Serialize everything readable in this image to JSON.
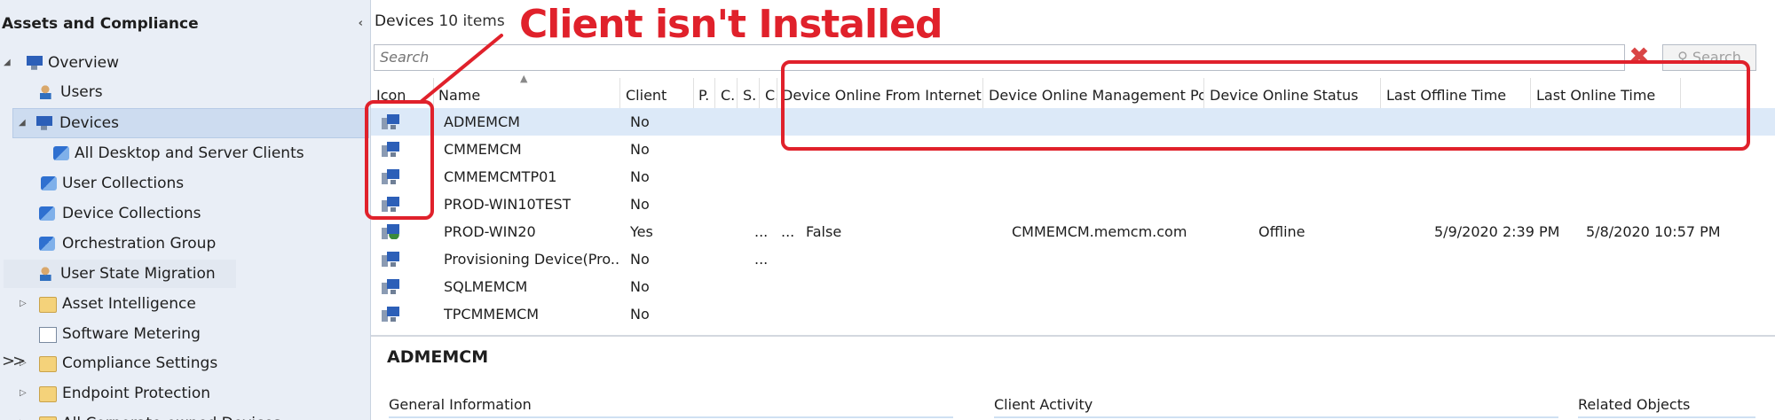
{
  "nav": {
    "title": "Assets and Compliance",
    "collapse_glyph": "‹",
    "items": [
      {
        "label": "Overview",
        "icon": "overview-icon",
        "expander": "◢"
      },
      {
        "label": "Users",
        "icon": "user-icon",
        "expander": ""
      },
      {
        "label": "Devices",
        "icon": "device-icon",
        "expander": "◢"
      },
      {
        "label": "All Desktop and Server Clients",
        "icon": "collection-icon",
        "expander": ""
      },
      {
        "label": "User Collections",
        "icon": "user-collection-icon",
        "expander": ""
      },
      {
        "label": "Device Collections",
        "icon": "device-collection-icon",
        "expander": ""
      },
      {
        "label": "Orchestration Group",
        "icon": "orchestration-icon",
        "expander": ""
      },
      {
        "label": "User State Migration",
        "icon": "migration-icon",
        "expander": ""
      },
      {
        "label": "Asset Intelligence",
        "icon": "folder-icon",
        "expander": "▷"
      },
      {
        "label": "Software Metering",
        "icon": "metering-icon",
        "expander": ""
      },
      {
        "label": "Compliance Settings",
        "icon": "folder-icon",
        "expander": "▷"
      },
      {
        "label": "Endpoint Protection",
        "icon": "folder-icon",
        "expander": "▷"
      },
      {
        "label": "All Corporate-owned Devices",
        "icon": "folder-icon",
        "expander": "▷"
      }
    ],
    "bottom_glyph": ">>"
  },
  "content": {
    "title": "Devices",
    "count": "10 items",
    "search_placeholder": "Search",
    "search_button": "Search",
    "clear_glyph": "✖",
    "columns": [
      "Icon",
      "Name",
      "Client",
      "P.",
      "C.",
      "S.",
      "C.",
      "Device Online From Internet",
      "Device Online Management Point",
      "Device Online Status",
      "Last Offline Time",
      "Last Online Time"
    ],
    "rows": [
      {
        "name": "ADMEMCM",
        "client": "No",
        "p": "",
        "c": "",
        "s": "",
        "c2": "",
        "internet": "",
        "mp": "",
        "status": "",
        "offline": "",
        "online": ""
      },
      {
        "name": "CMMEMCM",
        "client": "No",
        "p": "",
        "c": "",
        "s": "",
        "c2": "",
        "internet": "",
        "mp": "",
        "status": "",
        "offline": "",
        "online": ""
      },
      {
        "name": "CMMEMCMTP01",
        "client": "No",
        "p": "",
        "c": "",
        "s": "",
        "c2": "",
        "internet": "",
        "mp": "",
        "status": "",
        "offline": "",
        "online": ""
      },
      {
        "name": "PROD-WIN10TEST",
        "client": "No",
        "p": "",
        "c": "",
        "s": "",
        "c2": "",
        "internet": "",
        "mp": "",
        "status": "",
        "offline": "",
        "online": ""
      },
      {
        "name": "PROD-WIN20",
        "client": "Yes",
        "p": "",
        "c": "",
        "s": "...",
        "c2": "...",
        "internet": "False",
        "mp": "CMMEMCM.memcm.com",
        "status": "Offline",
        "offline": "5/9/2020 2:39 PM",
        "online": "5/8/2020 10:57 PM"
      },
      {
        "name": "Provisioning Device(Pro...",
        "client": "No",
        "p": "",
        "c": "",
        "s": "...",
        "c2": "",
        "internet": "",
        "mp": "",
        "status": "",
        "offline": "",
        "online": ""
      },
      {
        "name": "SQLMEMCM",
        "client": "No",
        "p": "",
        "c": "",
        "s": "",
        "c2": "",
        "internet": "",
        "mp": "",
        "status": "",
        "offline": "",
        "online": ""
      },
      {
        "name": "TPCMMEMCM",
        "client": "No",
        "p": "",
        "c": "",
        "s": "",
        "c2": "",
        "internet": "",
        "mp": "",
        "status": "",
        "offline": "",
        "online": ""
      }
    ],
    "details": {
      "title": "ADMEMCM",
      "sections": [
        "General Information",
        "Client Activity",
        "Related Objects"
      ]
    }
  },
  "annotation": {
    "text": "Client isn't Installed",
    "color": "#e0212b"
  }
}
